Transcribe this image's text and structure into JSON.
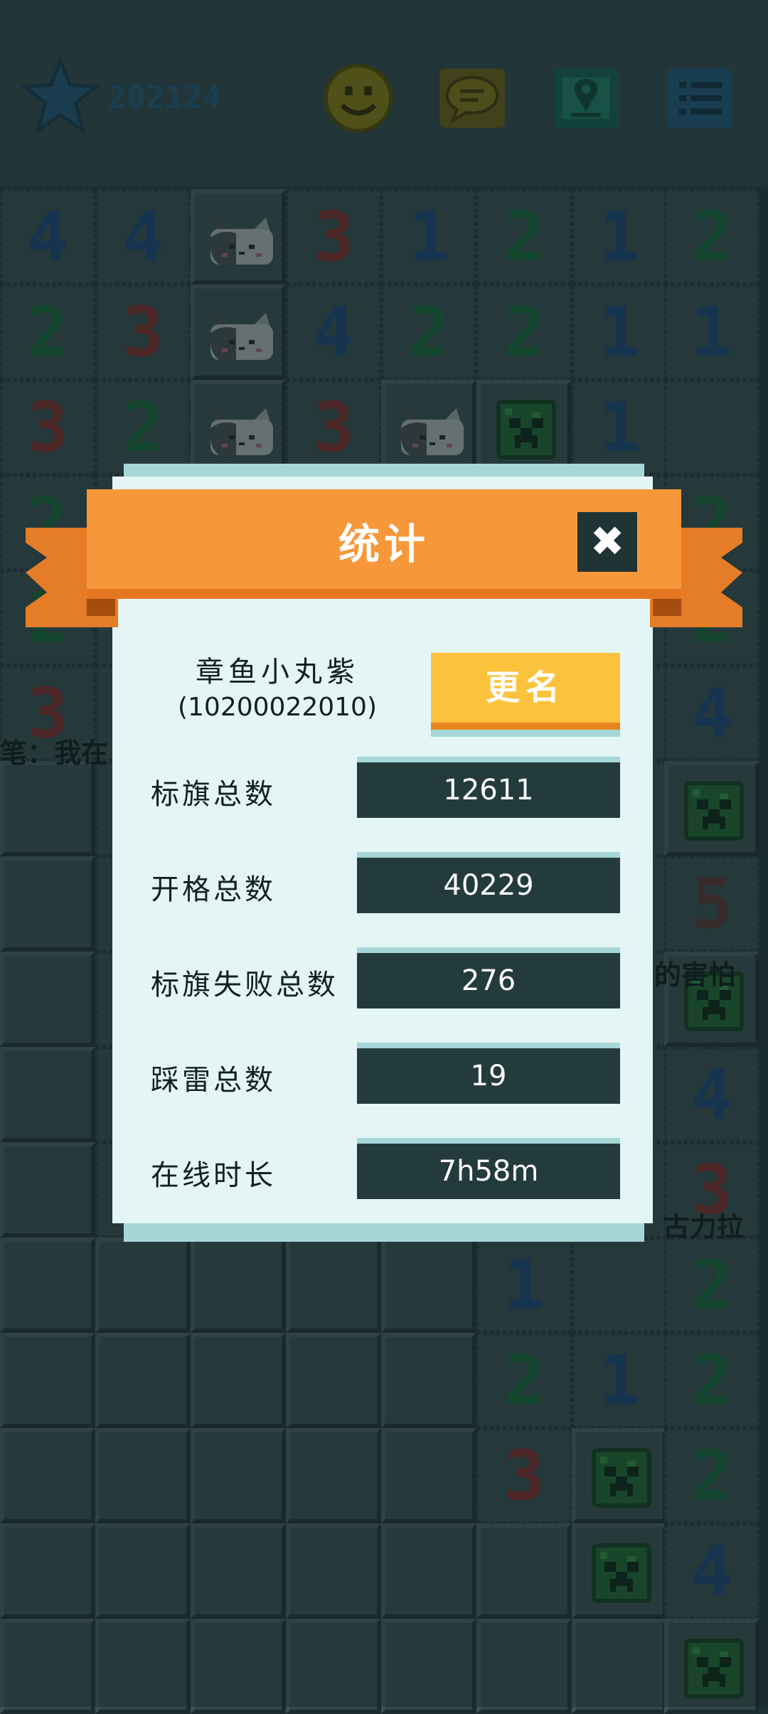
{
  "header": {
    "star_icon": "star-icon",
    "score": "202124",
    "buttons": [
      {
        "name": "smiley-button",
        "icon": "smiley-face-icon"
      },
      {
        "name": "chat-button",
        "icon": "chat-bubble-icon"
      },
      {
        "name": "map-button",
        "icon": "map-pin-icon"
      },
      {
        "name": "menu-button",
        "icon": "list-menu-icon"
      }
    ]
  },
  "board": {
    "rows": [
      [
        "4",
        "4",
        "cat",
        "3",
        "1",
        "2",
        "1",
        "2"
      ],
      [
        "2",
        "3",
        "cat",
        "4",
        "2",
        "2",
        "1",
        "1"
      ],
      [
        "3",
        "2",
        "cat",
        "3",
        "cat",
        "creeper",
        "1",
        ""
      ],
      [
        "2",
        "",
        "",
        "",
        "",
        "",
        "",
        "2"
      ],
      [
        "2",
        "",
        "",
        "",
        "",
        "",
        "",
        "2"
      ],
      [
        "3",
        "",
        "",
        "",
        "",
        "",
        "",
        "4"
      ],
      [
        "#",
        "",
        "",
        "",
        "",
        "",
        "",
        "creeper"
      ],
      [
        "#",
        "",
        "",
        "",
        "",
        "",
        "",
        "5"
      ],
      [
        "#",
        "",
        "",
        "",
        "",
        "",
        "",
        "creeper"
      ],
      [
        "#",
        "",
        "",
        "",
        "",
        "",
        "",
        "4"
      ],
      [
        "#",
        "",
        "",
        "",
        "",
        "",
        "",
        "3"
      ],
      [
        "#",
        "#",
        "#",
        "#",
        "#",
        "1",
        "",
        "2"
      ],
      [
        "#",
        "#",
        "#",
        "#",
        "#",
        "2",
        "1",
        "2"
      ],
      [
        "#",
        "#",
        "#",
        "#",
        "#",
        "3",
        "creeper",
        "2"
      ],
      [
        "#",
        "#",
        "#",
        "#",
        "#",
        "#",
        "creeper",
        "4"
      ],
      [
        "#",
        "#",
        "#",
        "#",
        "#",
        "#",
        "#",
        "creeper"
      ]
    ],
    "ticker_left": "笔：我在",
    "ticker_right_1": "的害怕",
    "ticker_right_2": "古力拉"
  },
  "dialog": {
    "title": "统计",
    "close_icon": "close-x-icon",
    "player_name": "章鱼小丸紫",
    "player_id": "(10200022010)",
    "rename_label": "更名",
    "stats": [
      {
        "label": "标旗总数",
        "value": "12611"
      },
      {
        "label": "开格总数",
        "value": "40229"
      },
      {
        "label": "标旗失败总数",
        "value": "276"
      },
      {
        "label": "踩雷总数",
        "value": "19"
      },
      {
        "label": "在线时长",
        "value": "7h58m"
      }
    ]
  },
  "colors": {
    "ribbon": "#f6983a",
    "ribbon_dark": "#e47c28",
    "dialog_bg": "#e3f6f5",
    "rename_button": "#fdc23c",
    "stat_box": "#243b3d",
    "board_bg": "#1f3234"
  }
}
